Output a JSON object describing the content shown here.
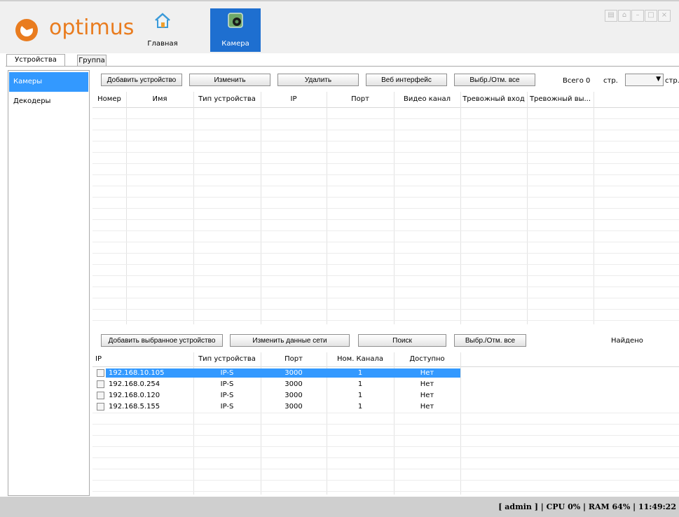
{
  "app": {
    "brand": "optimus",
    "brand_color": "#e97c1f",
    "accent": "#3399ff"
  },
  "nav": {
    "home_label": "Главная",
    "camera_label": "Камера",
    "active": "camera"
  },
  "window_controls": [
    "lock-icon",
    "shirt-icon",
    "minimize-icon",
    "maximize-icon",
    "close-icon"
  ],
  "tabs": [
    {
      "label": "Устройства",
      "active": true
    },
    {
      "label": "Группа",
      "active": false
    }
  ],
  "sidebar": {
    "items": [
      {
        "label": "Камеры",
        "selected": true
      },
      {
        "label": "Декодеры",
        "selected": false
      }
    ]
  },
  "device_toolbar": {
    "add_device": "Добавить устройство",
    "edit": "Изменить",
    "delete": "Удалить",
    "web_interface": "Веб интерфейс",
    "select_all": "Выбр./Отм. все",
    "total_label": "Всего 0",
    "page_label": "стр.",
    "page_select_value": "",
    "page_suffix": "стр."
  },
  "device_table": {
    "columns": [
      "Номер",
      "Имя",
      "Тип устройства",
      "IP",
      "Порт",
      "Видео канал",
      "Тревожный вход",
      "Тревожный вы..."
    ],
    "rows": []
  },
  "search_toolbar": {
    "add_selected": "Добавить выбранное устройство",
    "change_network": "Изменить данные сети",
    "search": "Поиск",
    "select_all": "Выбр./Отм. все",
    "found_label": "Найдено"
  },
  "search_table": {
    "columns": [
      "IP",
      "Тип устройства",
      "Порт",
      "Ном. Канала",
      "Доступно"
    ],
    "rows": [
      {
        "ip": "192.168.10.105",
        "type": "IP-S",
        "port": "3000",
        "channel": "1",
        "available": "Нет",
        "selected": true
      },
      {
        "ip": "192.168.0.254",
        "type": "IP-S",
        "port": "3000",
        "channel": "1",
        "available": "Нет",
        "selected": false
      },
      {
        "ip": "192.168.0.120",
        "type": "IP-S",
        "port": "3000",
        "channel": "1",
        "available": "Нет",
        "selected": false
      },
      {
        "ip": "192.168.5.155",
        "type": "IP-S",
        "port": "3000",
        "channel": "1",
        "available": "Нет",
        "selected": false
      }
    ]
  },
  "status_bar": {
    "text": "[ admin ] | CPU  0% | RAM  64% | 11:49:22"
  }
}
